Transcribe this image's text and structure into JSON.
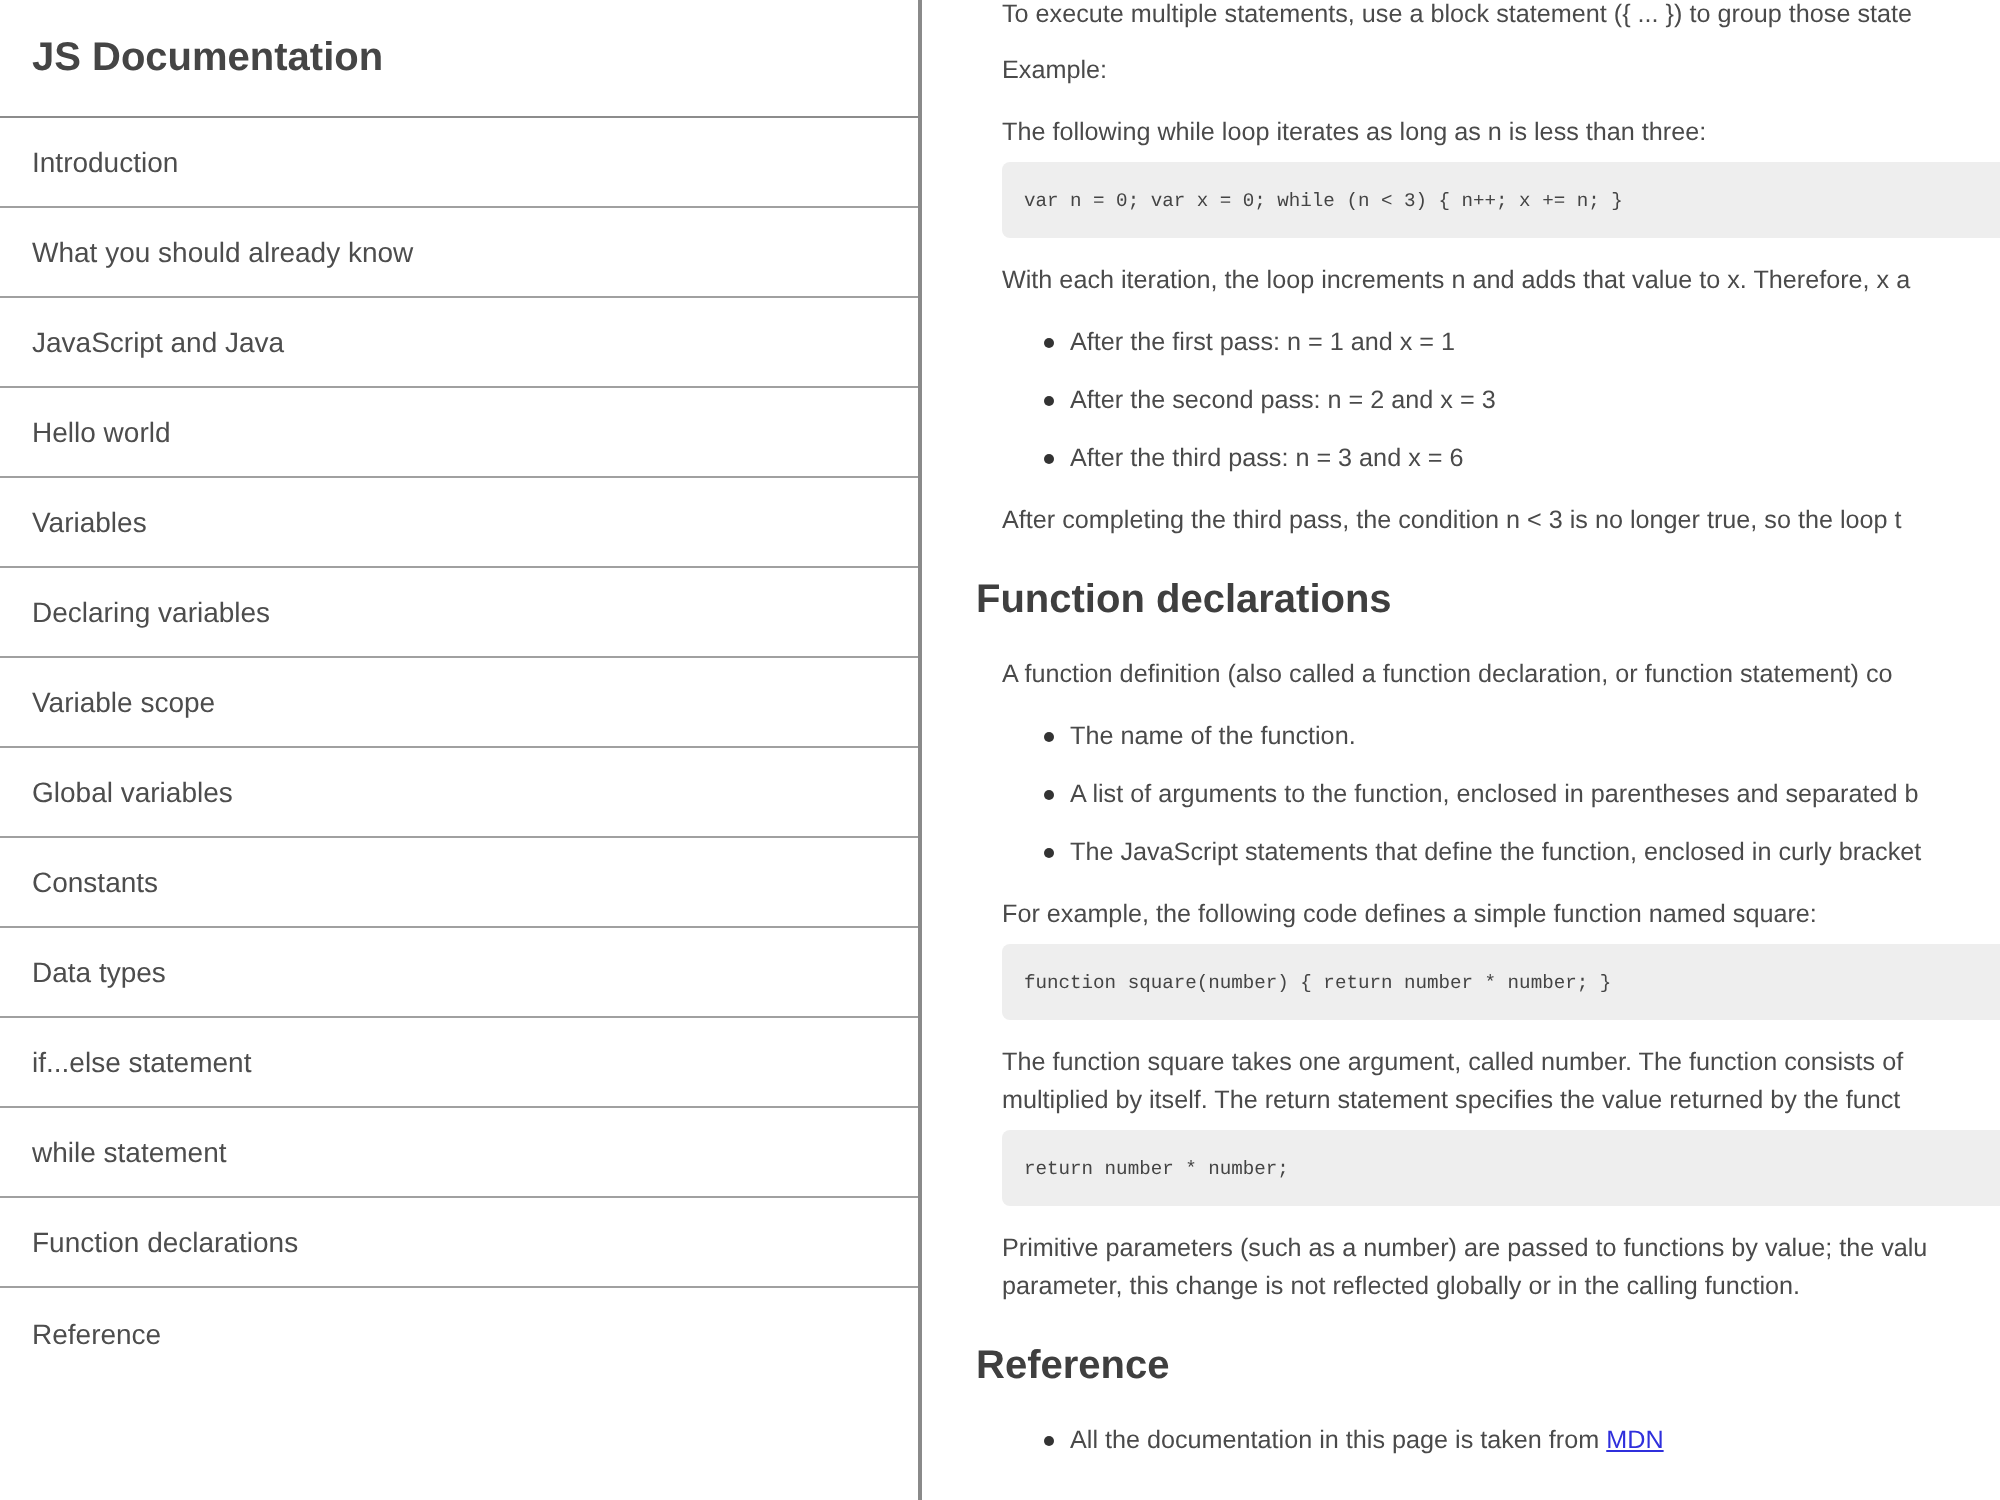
{
  "sidebar": {
    "title": "JS Documentation",
    "items": [
      "Introduction",
      "What you should already know",
      "JavaScript and Java",
      "Hello world",
      "Variables",
      "Declaring variables",
      "Variable scope",
      "Global variables",
      "Constants",
      "Data types",
      "if...else statement",
      "while statement",
      "Function declarations",
      "Reference"
    ]
  },
  "content": [
    {
      "kind": "paragraph",
      "lines": [
        "To execute multiple statements, use a block statement ({ ... }) to group those state"
      ]
    },
    {
      "kind": "paragraph",
      "lines": [
        "Example:"
      ]
    },
    {
      "kind": "paragraph",
      "lines": [
        "The following while loop iterates as long as n is less than three:"
      ]
    },
    {
      "kind": "code",
      "text": "var n = 0; var x = 0; while (n < 3) { n++; x += n; }"
    },
    {
      "kind": "paragraph",
      "lines": [
        "With each iteration, the loop increments n and adds that value to x. Therefore, x a"
      ]
    },
    {
      "kind": "list",
      "items": [
        {
          "text": "After the first pass: n = 1 and x = 1"
        },
        {
          "text": "After the second pass: n = 2 and x = 3"
        },
        {
          "text": "After the third pass: n = 3 and x = 6"
        }
      ]
    },
    {
      "kind": "paragraph",
      "lines": [
        "After completing the third pass, the condition n < 3 is no longer true, so the loop t"
      ]
    },
    {
      "kind": "heading",
      "text": "Function declarations"
    },
    {
      "kind": "paragraph",
      "lines": [
        "A function definition (also called a function declaration, or function statement) co"
      ]
    },
    {
      "kind": "list",
      "items": [
        {
          "text": "The name of the function."
        },
        {
          "text": "A list of arguments to the function, enclosed in parentheses and separated b"
        },
        {
          "text": "The JavaScript statements that define the function, enclosed in curly bracket"
        }
      ]
    },
    {
      "kind": "paragraph",
      "lines": [
        "For example, the following code defines a simple function named square:"
      ]
    },
    {
      "kind": "code",
      "text": "function square(number) { return number * number; }"
    },
    {
      "kind": "paragraph",
      "lines": [
        "The function square takes one argument, called number. The function consists of",
        "multiplied by itself. The return statement specifies the value returned by the funct"
      ]
    },
    {
      "kind": "code",
      "text": "return number * number;"
    },
    {
      "kind": "paragraph",
      "lines": [
        "Primitive parameters (such as a number) are passed to functions by value; the valu",
        "parameter, this change is not reflected globally or in the calling function."
      ]
    },
    {
      "kind": "heading",
      "text": "Reference"
    },
    {
      "kind": "list",
      "items": [
        {
          "text": "All the documentation in this page is taken from",
          "link": "MDN"
        }
      ]
    }
  ]
}
